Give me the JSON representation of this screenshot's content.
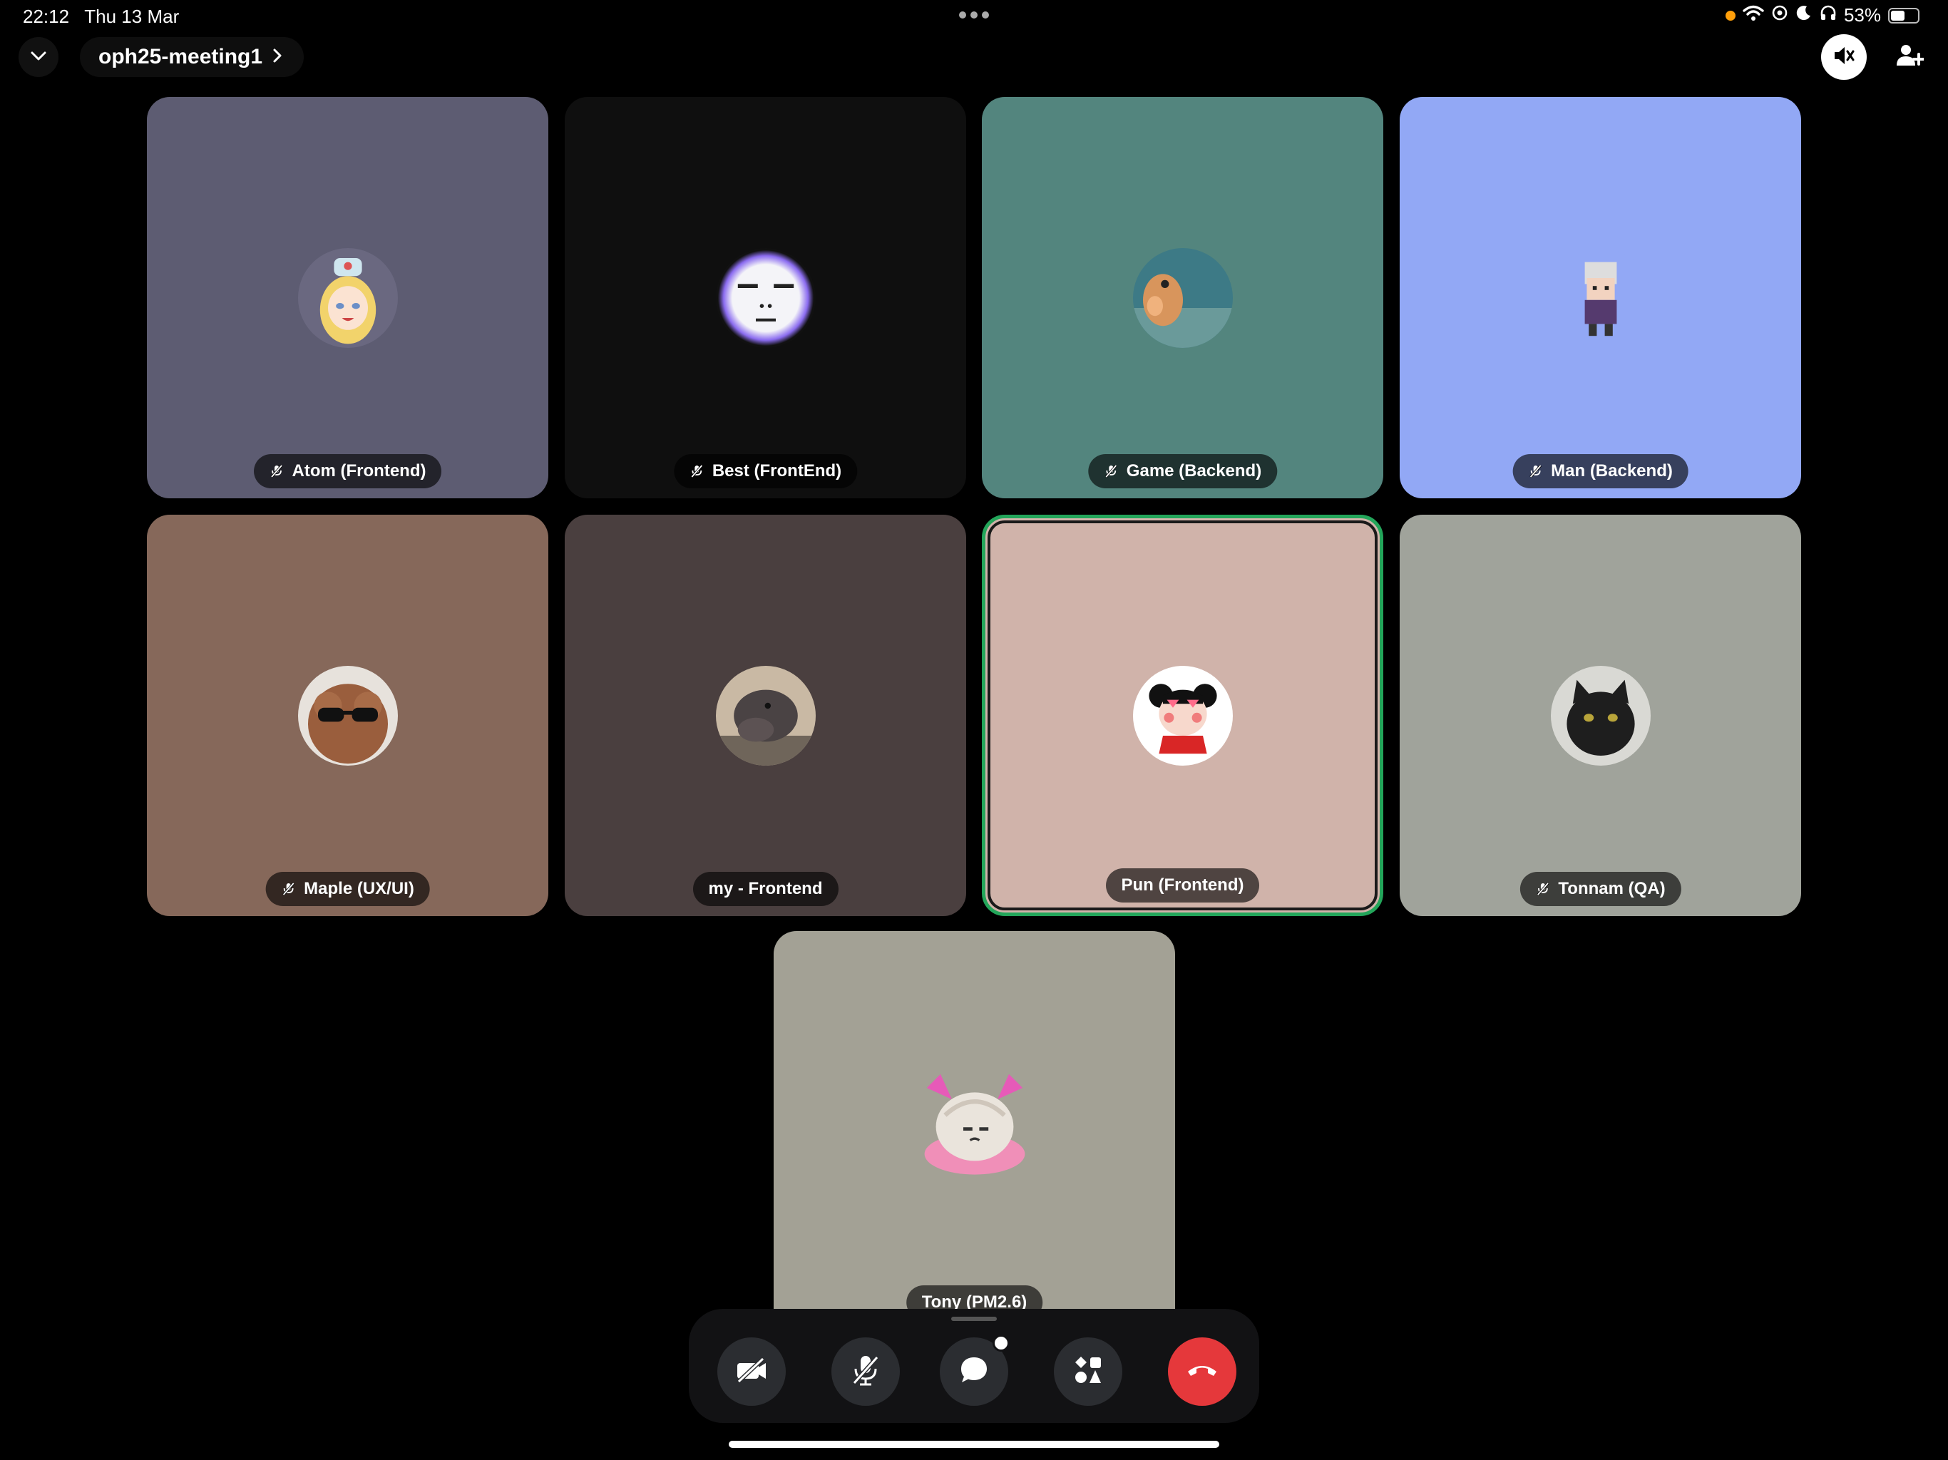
{
  "status_bar": {
    "time": "22:12",
    "date": "Thu 13 Mar",
    "battery": "53%",
    "battery_level": 0.53,
    "icons": [
      "wifi-icon",
      "focus-icon",
      "moon-icon",
      "headphones-icon",
      "battery-icon"
    ]
  },
  "header": {
    "channel_name": "oph25-meeting1",
    "collapse_icon": "chevron-down-icon",
    "channel_arrow_icon": "chevron-right-icon",
    "speaker_icon": "speaker-bluetooth-icon",
    "add_user_icon": "add-user-icon"
  },
  "participants": [
    {
      "name": "Atom (Frontend)",
      "muted": true,
      "bg": "#5d5c72",
      "avatar": "anime-girl-avatar",
      "speaking": false
    },
    {
      "name": "Best (FrontEnd)",
      "muted": true,
      "bg": "#0f0f0f",
      "avatar": "glowing-face-avatar",
      "speaking": false
    },
    {
      "name": "Game (Backend)",
      "muted": true,
      "bg": "#53857e",
      "avatar": "fish-avatar",
      "speaking": false
    },
    {
      "name": "Man (Backend)",
      "muted": true,
      "bg": "#92a8f5",
      "avatar": "pixel-character-avatar",
      "speaking": false
    },
    {
      "name": "Maple (UX/UI)",
      "muted": true,
      "bg": "#86685a",
      "avatar": "dog-sunglasses-avatar",
      "speaking": false
    },
    {
      "name": "my - Frontend",
      "muted": false,
      "bg": "#4a3f3f",
      "avatar": "hippo-avatar",
      "speaking": false
    },
    {
      "name": "Pun (Frontend)",
      "muted": false,
      "bg": "#d0b3aa",
      "avatar": "cartoon-girl-avatar",
      "speaking": true
    },
    {
      "name": "Tonnam (QA)",
      "muted": true,
      "bg": "#a0a39b",
      "avatar": "black-cat-avatar",
      "speaking": false
    },
    {
      "name": "Tony (PM2.6)",
      "muted": false,
      "bg": "#a3a195",
      "avatar": "dumpling-avatar",
      "speaking": false
    }
  ],
  "controls": {
    "items": [
      "camera-off-icon",
      "mic-off-icon",
      "chat-icon",
      "activities-icon",
      "end-call-icon"
    ],
    "chat_has_notification": true,
    "colors": {
      "bar": "#121214",
      "button": "#2b2d31",
      "end": "#e5383b",
      "speaking_border": "#23a55a"
    }
  }
}
